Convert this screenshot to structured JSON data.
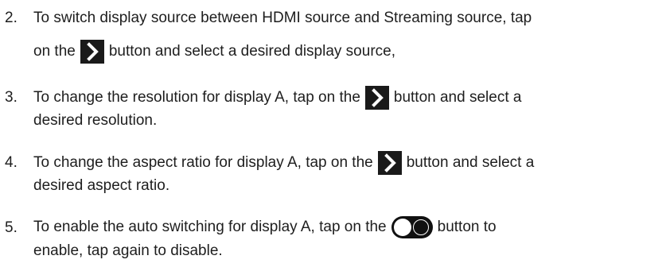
{
  "steps": [
    {
      "number": "2.",
      "line1_a": "To switch display source between HDMI source and Streaming source, tap",
      "line2_a": "on the",
      "line2_b": "button and select a desired display source,",
      "icon": "chevron-right-icon"
    },
    {
      "number": "3.",
      "line1_a": "To change the resolution for display A, tap on the",
      "line1_b": "button and select a",
      "line2_a": "desired resolution.",
      "icon": "chevron-right-icon"
    },
    {
      "number": "4.",
      "line1_a": "To change the aspect ratio for display A, tap on the",
      "line1_b": "button and select a",
      "line2_a": "desired aspect ratio.",
      "icon": "chevron-right-icon"
    },
    {
      "number": "5.",
      "line1_a": "To enable the auto switching for display A, tap on the",
      "line1_b": "button to",
      "line2_a": "enable, tap again to disable.",
      "icon": "toggle-switch-icon"
    }
  ]
}
